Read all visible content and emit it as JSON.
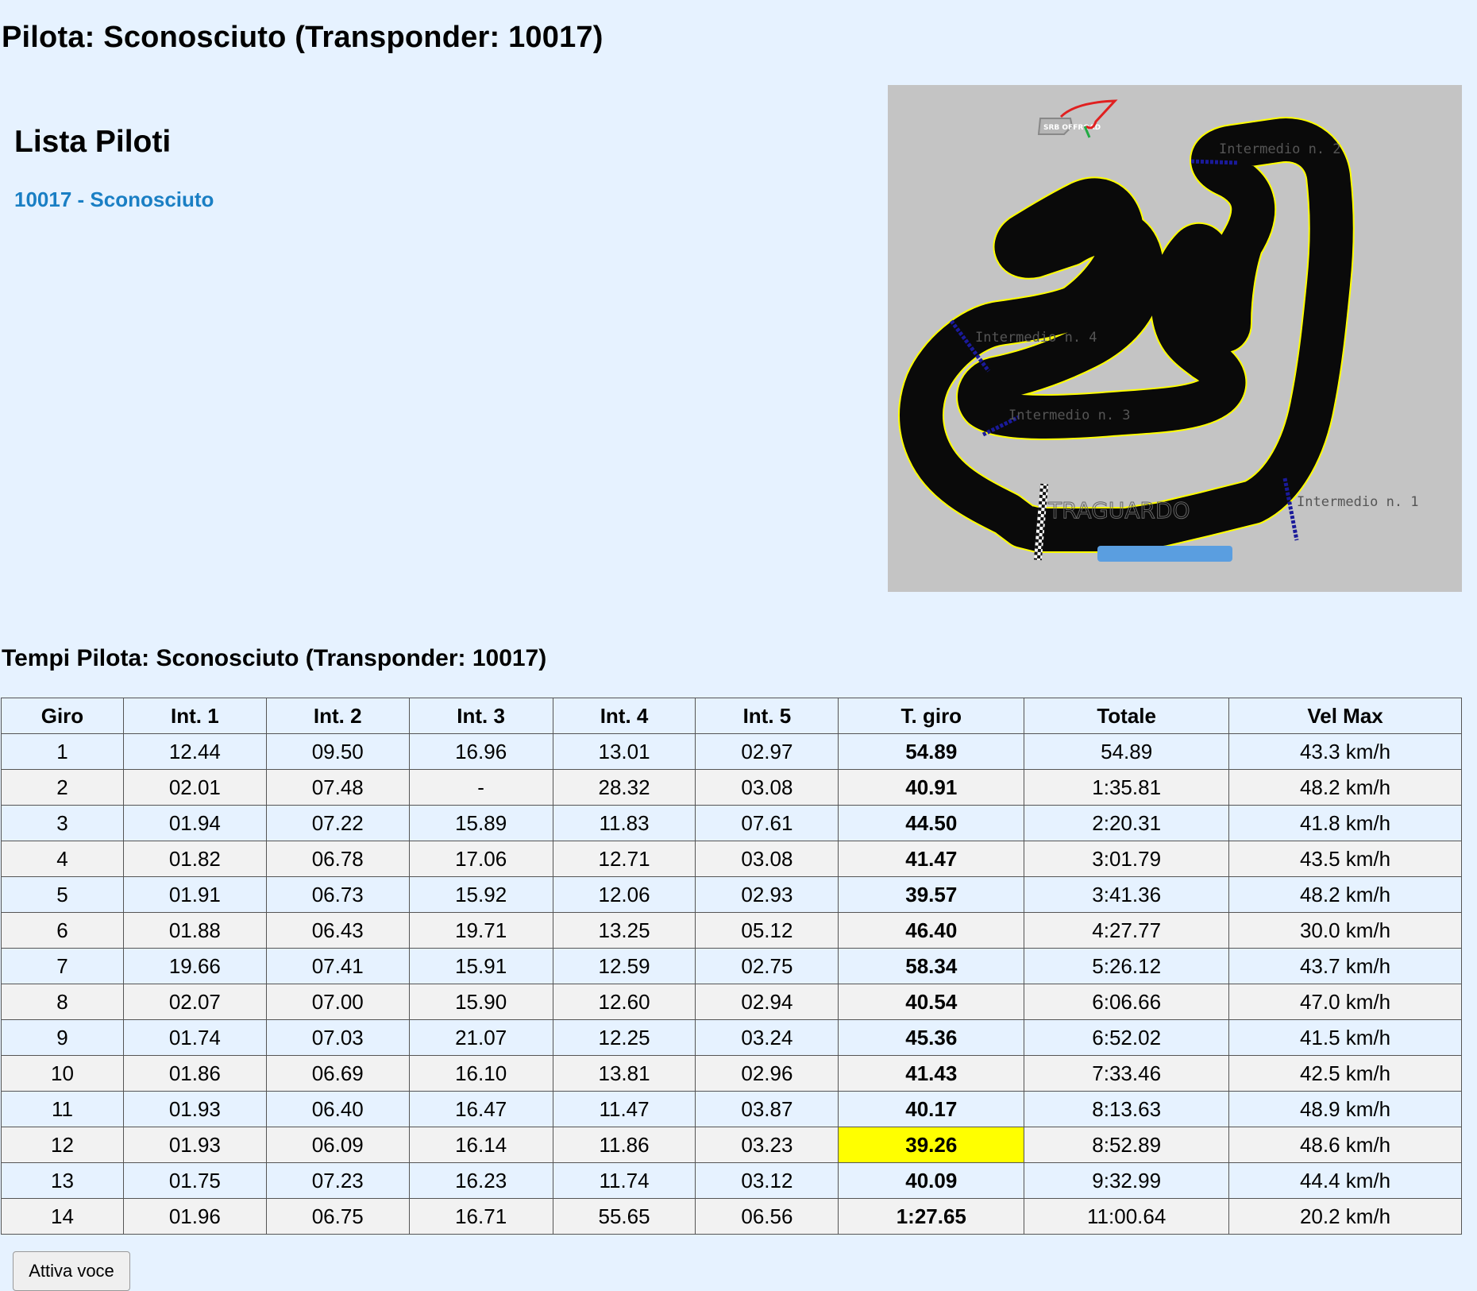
{
  "page_title": "Pilota: Sconosciuto (Transponder: 10017)",
  "pilot_list": {
    "title": "Lista Piloti",
    "items": [
      "10017 - Sconosciuto"
    ]
  },
  "track_map": {
    "labels": {
      "int1": "Intermedio n. 1",
      "int2": "Intermedio n. 2",
      "int3": "Intermedio n. 3",
      "int4": "Intermedio n. 4",
      "finish": "TRAGUARDO"
    },
    "logo_text": "SRB OFFROAD"
  },
  "times_title": "Tempi Pilota: Sconosciuto (Transponder: 10017)",
  "table": {
    "headers": [
      "Giro",
      "Int. 1",
      "Int. 2",
      "Int. 3",
      "Int. 4",
      "Int. 5",
      "T. giro",
      "Totale",
      "Vel Max"
    ],
    "best_lap_row": 11,
    "rows": [
      [
        "1",
        "12.44",
        "09.50",
        "16.96",
        "13.01",
        "02.97",
        "54.89",
        "54.89",
        "43.3 km/h"
      ],
      [
        "2",
        "02.01",
        "07.48",
        "-",
        "28.32",
        "03.08",
        "40.91",
        "1:35.81",
        "48.2 km/h"
      ],
      [
        "3",
        "01.94",
        "07.22",
        "15.89",
        "11.83",
        "07.61",
        "44.50",
        "2:20.31",
        "41.8 km/h"
      ],
      [
        "4",
        "01.82",
        "06.78",
        "17.06",
        "12.71",
        "03.08",
        "41.47",
        "3:01.79",
        "43.5 km/h"
      ],
      [
        "5",
        "01.91",
        "06.73",
        "15.92",
        "12.06",
        "02.93",
        "39.57",
        "3:41.36",
        "48.2 km/h"
      ],
      [
        "6",
        "01.88",
        "06.43",
        "19.71",
        "13.25",
        "05.12",
        "46.40",
        "4:27.77",
        "30.0 km/h"
      ],
      [
        "7",
        "19.66",
        "07.41",
        "15.91",
        "12.59",
        "02.75",
        "58.34",
        "5:26.12",
        "43.7 km/h"
      ],
      [
        "8",
        "02.07",
        "07.00",
        "15.90",
        "12.60",
        "02.94",
        "40.54",
        "6:06.66",
        "47.0 km/h"
      ],
      [
        "9",
        "01.74",
        "07.03",
        "21.07",
        "12.25",
        "03.24",
        "45.36",
        "6:52.02",
        "41.5 km/h"
      ],
      [
        "10",
        "01.86",
        "06.69",
        "16.10",
        "13.81",
        "02.96",
        "41.43",
        "7:33.46",
        "42.5 km/h"
      ],
      [
        "11",
        "01.93",
        "06.40",
        "16.47",
        "11.47",
        "03.87",
        "40.17",
        "8:13.63",
        "48.9 km/h"
      ],
      [
        "12",
        "01.93",
        "06.09",
        "16.14",
        "11.86",
        "03.23",
        "39.26",
        "8:52.89",
        "48.6 km/h"
      ],
      [
        "13",
        "01.75",
        "07.23",
        "16.23",
        "11.74",
        "03.12",
        "40.09",
        "9:32.99",
        "44.4 km/h"
      ],
      [
        "14",
        "01.96",
        "06.75",
        "16.71",
        "55.65",
        "06.56",
        "1:27.65",
        "11:00.64",
        "20.2 km/h"
      ]
    ]
  },
  "voice_button": "Attiva voce",
  "colors": {
    "background": "#e6f2ff",
    "link": "#1a7fc4",
    "best_lap_highlight": "#ffff00",
    "track": "#0a0a0a",
    "track_border": "#ffff00",
    "map_background": "#c4c4c4"
  }
}
